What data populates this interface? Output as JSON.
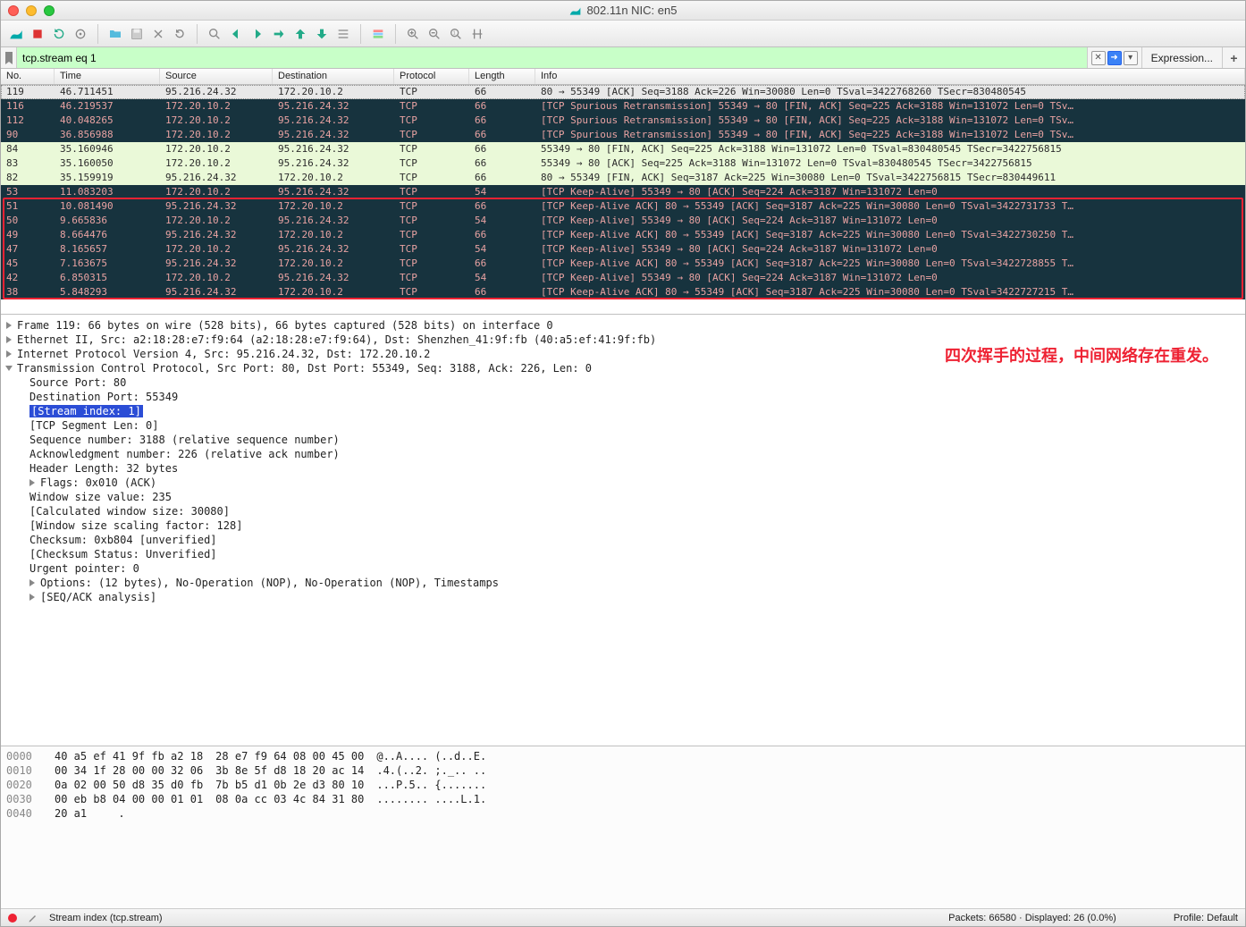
{
  "title": "802.11n NIC: en5",
  "filter": {
    "value": "tcp.stream eq 1",
    "expression_label": "Expression...",
    "add_label": "+"
  },
  "columns": {
    "no": "No.",
    "time": "Time",
    "source": "Source",
    "destination": "Destination",
    "protocol": "Protocol",
    "length": "Length",
    "info": "Info"
  },
  "packets": [
    {
      "no": "38",
      "time": "5.848293",
      "src": "95.216.24.32",
      "dst": "172.20.10.2",
      "proto": "TCP",
      "len": "66",
      "info": "[TCP Keep-Alive ACK] 80 → 55349 [ACK] Seq=3187 Ack=225 Win=30080 Len=0 TSval=3422727215 T…",
      "style": "dark"
    },
    {
      "no": "42",
      "time": "6.850315",
      "src": "172.20.10.2",
      "dst": "95.216.24.32",
      "proto": "TCP",
      "len": "54",
      "info": "[TCP Keep-Alive] 55349 → 80 [ACK] Seq=224 Ack=3187 Win=131072 Len=0",
      "style": "dark"
    },
    {
      "no": "45",
      "time": "7.163675",
      "src": "95.216.24.32",
      "dst": "172.20.10.2",
      "proto": "TCP",
      "len": "66",
      "info": "[TCP Keep-Alive ACK] 80 → 55349 [ACK] Seq=3187 Ack=225 Win=30080 Len=0 TSval=3422728855 T…",
      "style": "dark"
    },
    {
      "no": "47",
      "time": "8.165657",
      "src": "172.20.10.2",
      "dst": "95.216.24.32",
      "proto": "TCP",
      "len": "54",
      "info": "[TCP Keep-Alive] 55349 → 80 [ACK] Seq=224 Ack=3187 Win=131072 Len=0",
      "style": "dark"
    },
    {
      "no": "49",
      "time": "8.664476",
      "src": "95.216.24.32",
      "dst": "172.20.10.2",
      "proto": "TCP",
      "len": "66",
      "info": "[TCP Keep-Alive ACK] 80 → 55349 [ACK] Seq=3187 Ack=225 Win=30080 Len=0 TSval=3422730250 T…",
      "style": "dark"
    },
    {
      "no": "50",
      "time": "9.665836",
      "src": "172.20.10.2",
      "dst": "95.216.24.32",
      "proto": "TCP",
      "len": "54",
      "info": "[TCP Keep-Alive] 55349 → 80 [ACK] Seq=224 Ack=3187 Win=131072 Len=0",
      "style": "dark"
    },
    {
      "no": "51",
      "time": "10.081490",
      "src": "95.216.24.32",
      "dst": "172.20.10.2",
      "proto": "TCP",
      "len": "66",
      "info": "[TCP Keep-Alive ACK] 80 → 55349 [ACK] Seq=3187 Ack=225 Win=30080 Len=0 TSval=3422731733 T…",
      "style": "dark"
    },
    {
      "no": "53",
      "time": "11.083203",
      "src": "172.20.10.2",
      "dst": "95.216.24.32",
      "proto": "TCP",
      "len": "54",
      "info": "[TCP Keep-Alive] 55349 → 80 [ACK] Seq=224 Ack=3187 Win=131072 Len=0",
      "style": "dark"
    },
    {
      "no": "82",
      "time": "35.159919",
      "src": "95.216.24.32",
      "dst": "172.20.10.2",
      "proto": "TCP",
      "len": "66",
      "info": "80 → 55349 [FIN, ACK] Seq=3187 Ack=225 Win=30080 Len=0 TSval=3422756815 TSecr=830449611",
      "style": "fin"
    },
    {
      "no": "83",
      "time": "35.160050",
      "src": "172.20.10.2",
      "dst": "95.216.24.32",
      "proto": "TCP",
      "len": "66",
      "info": "55349 → 80 [ACK] Seq=225 Ack=3188 Win=131072 Len=0 TSval=830480545 TSecr=3422756815",
      "style": "fin"
    },
    {
      "no": "84",
      "time": "35.160946",
      "src": "172.20.10.2",
      "dst": "95.216.24.32",
      "proto": "TCP",
      "len": "66",
      "info": "55349 → 80 [FIN, ACK] Seq=225 Ack=3188 Win=131072 Len=0 TSval=830480545 TSecr=3422756815",
      "style": "fin"
    },
    {
      "no": "90",
      "time": "36.856988",
      "src": "172.20.10.2",
      "dst": "95.216.24.32",
      "proto": "TCP",
      "len": "66",
      "info": "[TCP Spurious Retransmission] 55349 → 80 [FIN, ACK] Seq=225 Ack=3188 Win=131072 Len=0 TSv…",
      "style": "retr"
    },
    {
      "no": "112",
      "time": "40.048265",
      "src": "172.20.10.2",
      "dst": "95.216.24.32",
      "proto": "TCP",
      "len": "66",
      "info": "[TCP Spurious Retransmission] 55349 → 80 [FIN, ACK] Seq=225 Ack=3188 Win=131072 Len=0 TSv…",
      "style": "retr"
    },
    {
      "no": "116",
      "time": "46.219537",
      "src": "172.20.10.2",
      "dst": "95.216.24.32",
      "proto": "TCP",
      "len": "66",
      "info": "[TCP Spurious Retransmission] 55349 → 80 [FIN, ACK] Seq=225 Ack=3188 Win=131072 Len=0 TSv…",
      "style": "retr"
    },
    {
      "no": "119",
      "time": "46.711451",
      "src": "95.216.24.32",
      "dst": "172.20.10.2",
      "proto": "TCP",
      "len": "66",
      "info": "80 → 55349 [ACK] Seq=3188 Ack=226 Win=30080 Len=0 TSval=3422768260 TSecr=830480545",
      "style": "last"
    }
  ],
  "details": {
    "frame": "Frame 119: 66 bytes on wire (528 bits), 66 bytes captured (528 bits) on interface 0",
    "eth": "Ethernet II, Src: a2:18:28:e7:f9:64 (a2:18:28:e7:f9:64), Dst: Shenzhen_41:9f:fb (40:a5:ef:41:9f:fb)",
    "ip": "Internet Protocol Version 4, Src: 95.216.24.32, Dst: 172.20.10.2",
    "tcp": "Transmission Control Protocol, Src Port: 80, Dst Port: 55349, Seq: 3188, Ack: 226, Len: 0",
    "src_port": "Source Port: 80",
    "dst_port": "Destination Port: 55349",
    "stream": "[Stream index: 1]",
    "tcpseglen": "[TCP Segment Len: 0]",
    "seq": "Sequence number: 3188    (relative sequence number)",
    "ack": "Acknowledgment number: 226    (relative ack number)",
    "hdr": "Header Length: 32 bytes",
    "flags": "Flags: 0x010 (ACK)",
    "win": "Window size value: 235",
    "calcwin": "[Calculated window size: 30080]",
    "scale": "[Window size scaling factor: 128]",
    "cksum": "Checksum: 0xb804 [unverified]",
    "cksumst": "[Checksum Status: Unverified]",
    "urg": "Urgent pointer: 0",
    "opts": "Options: (12 bytes), No-Operation (NOP), No-Operation (NOP), Timestamps",
    "seqack": "[SEQ/ACK analysis]"
  },
  "annotation": "四次挥手的过程，中间网络存在重发。",
  "hex": [
    {
      "off": "0000",
      "b1": "40 a5 ef 41 9f fb a2 18",
      "b2": "28 e7 f9 64 08 00 45 00",
      "ascii": "@..A.... (..d..E."
    },
    {
      "off": "0010",
      "b1": "00 34 1f 28 00 00 32 06",
      "b2": "3b 8e 5f d8 18 20 ac 14",
      "ascii": ".4.(..2. ;._.. .."
    },
    {
      "off": "0020",
      "b1": "0a 02 00 50 d8 35 d0 fb",
      "b2": "7b b5 d1 0b 2e d3 80 10",
      "ascii": "...P.5.. {......."
    },
    {
      "off": "0030",
      "b1": "00 eb b8 04 00 00 01 01",
      "b2": "08 0a cc 03 4c 84 31 80",
      "ascii": "........ ....L.1."
    },
    {
      "off": "0040",
      "b1": "20 a1",
      "b2": "",
      "ascii": " ."
    }
  ],
  "status": {
    "field": "Stream index (tcp.stream)",
    "stats": "Packets: 66580 · Displayed: 26 (0.0%)",
    "profile": "Profile: Default"
  }
}
